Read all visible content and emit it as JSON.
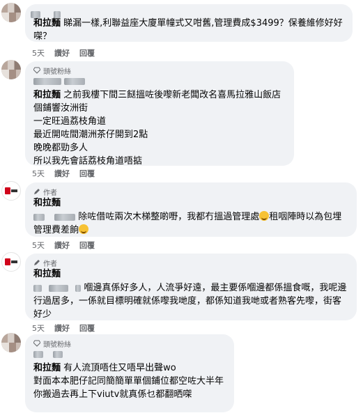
{
  "comments": [
    {
      "author": "和拉麵",
      "text": "睇漏一樣,利聯益座大廈單幢式又咁舊,管理費成$3499？保養維修好好㗎？",
      "time": "5天",
      "like": "讚好",
      "reply": "回覆"
    },
    {
      "badge": "頭號粉絲",
      "author": "和拉麵",
      "lines": [
        "之前我樓下間三餸搵咗後嚟新老闆改名喜馬拉雅山飯店",
        "個鋪響汝洲街",
        "一定旺過荔枝角道",
        "最近開咗間潮洲茶仔開到2點",
        "晚晚都勁多人",
        "所以我先會話荔枝角道唔掂"
      ],
      "time": "5天",
      "like": "讚好",
      "reply": "回覆"
    },
    {
      "badge": "作者",
      "author": "和拉麵",
      "text": "除咗借咗兩次木梯整啲嘢，我都冇搵過管理處",
      "text2": "租咽陣時以為包埋管理費差餉",
      "time": "5天",
      "like": "讚好",
      "reply": "回覆"
    },
    {
      "badge": "作者",
      "author": "和拉麵",
      "text": "嗰邊真係好多人，人流爭好遠，最主要係嗰邊都係搵食嘅，我呢邊行過居多，一係就目標明確就係嚟我哋度，都係知道我哋或者熟客先嚟，街客好少",
      "time": "5天",
      "like": "讚好",
      "reply": "回覆"
    },
    {
      "badge": "頭號粉絲",
      "author": "和拉麵",
      "lines": [
        "有人流頂唔住又唔早出聲wo",
        "對面本本肥仔記同簡簡單單個鋪位都空咗大半年",
        "你搬過去再上下viutv就真係乜都翻晒㗎"
      ]
    }
  ]
}
